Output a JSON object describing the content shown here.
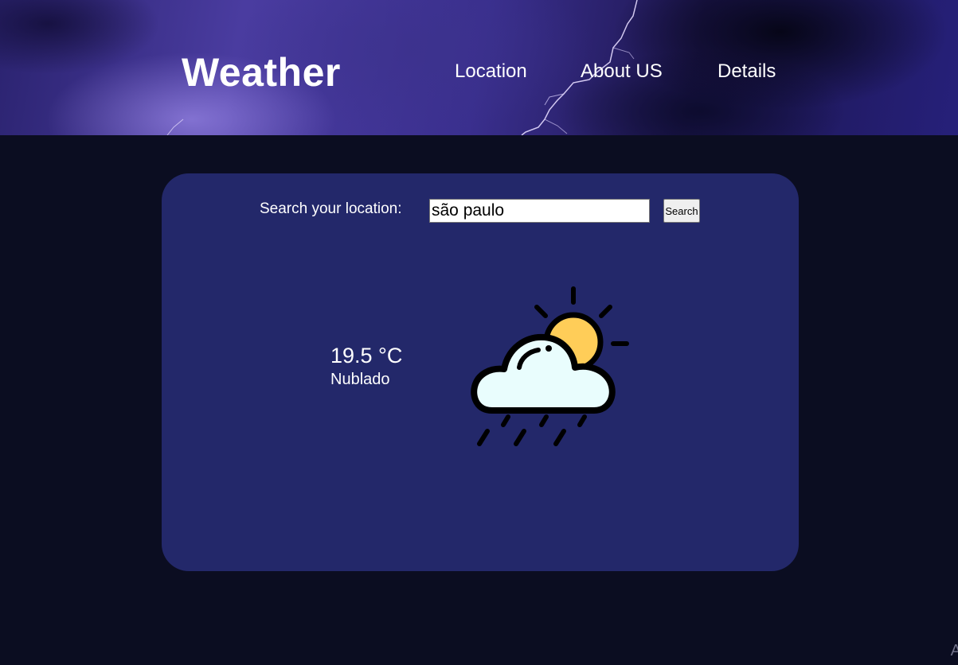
{
  "header": {
    "logo": "Weather",
    "nav": [
      "Location",
      "About US",
      "Details"
    ]
  },
  "search": {
    "label": "Search your location:",
    "value": "são paulo",
    "button_label": "Search"
  },
  "weather": {
    "temperature": "19.5 °C",
    "condition": "Nublado",
    "icon": "partly-cloudy-rain-icon"
  },
  "footer": {
    "corner_text": "A"
  },
  "colors": {
    "background": "#0b0d21",
    "card": "#23286a",
    "sun": "#ffcd58",
    "cloud": "#e9fdfd"
  }
}
